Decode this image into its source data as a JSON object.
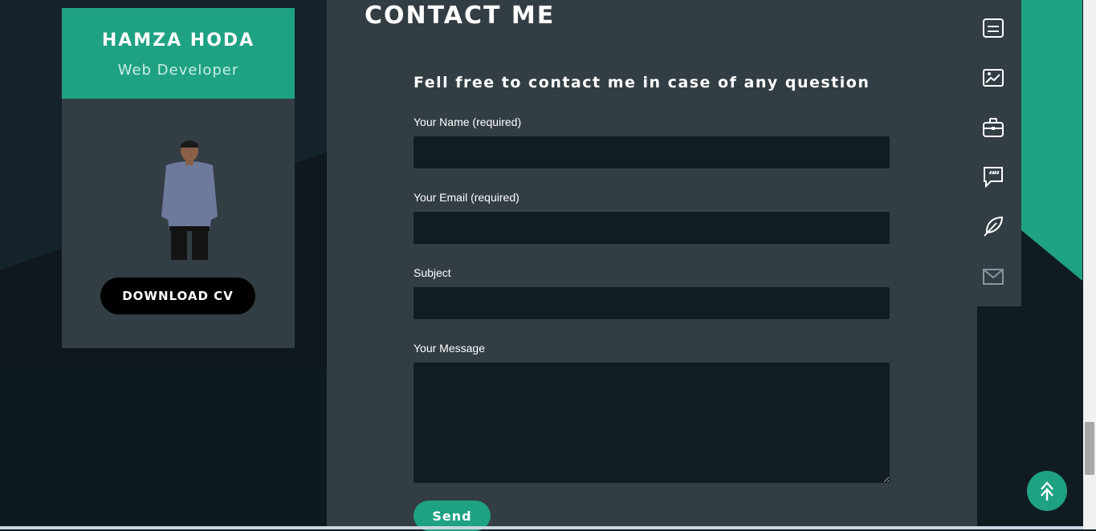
{
  "profile": {
    "name": "HAMZA HODA",
    "role": "Web Developer",
    "download_label": "DOWNLOAD CV"
  },
  "contact": {
    "title": "CONTACT ME",
    "intro": "Fell free to contact me in case of any question",
    "fields": {
      "name_label": "Your Name (required)",
      "email_label": "Your Email (required)",
      "subject_label": "Subject",
      "message_label": "Your Message"
    },
    "send_label": "Send"
  },
  "side_nav": {
    "icons": [
      "resume-icon",
      "portfolio-icon",
      "briefcase-icon",
      "testimonial-icon",
      "blog-feather-icon",
      "mail-icon"
    ]
  },
  "colors": {
    "accent": "#1fa183",
    "panel": "#333d44",
    "background": "#121d24",
    "input": "#121c23"
  }
}
